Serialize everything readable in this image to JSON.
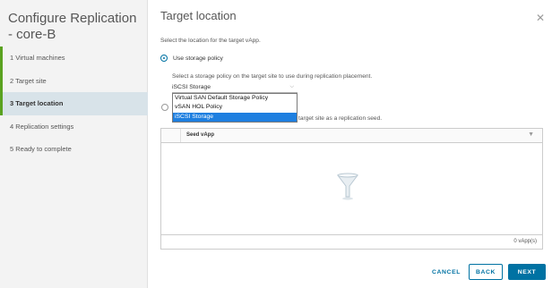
{
  "wizard": {
    "title": "Configure Replication - core-B",
    "steps": [
      {
        "label": "1  Virtual machines"
      },
      {
        "label": "2  Target site"
      },
      {
        "label": "3  Target location"
      },
      {
        "label": "4  Replication settings"
      },
      {
        "label": "5  Ready to complete"
      }
    ]
  },
  "page": {
    "title": "Target location",
    "subtitle": "Select the location for the target vApp.",
    "radio_storage_policy": "Use storage policy",
    "storage_policy_helper": "Select a storage policy on the target site to use during replication placement.",
    "storage_policy_selected": "iSCSI Storage",
    "storage_policy_options": [
      "Virtual SAN Default Storage Policy",
      "vSAN HOL Policy",
      "iSCSI Storage"
    ],
    "seed_text_visible": "target site as a replication seed."
  },
  "grid": {
    "column_header": "Seed vApp",
    "footer_count": "0 vApp(s)"
  },
  "footer": {
    "cancel": "CANCEL",
    "back": "BACK",
    "next": "NEXT"
  },
  "colors": {
    "accent": "#0072a3",
    "active_step_bg": "#d8e3e9",
    "completed_step": "#5aa220",
    "dropdown_highlight": "#1e7fe0"
  },
  "icons": {
    "close": "close-icon",
    "filter": "filter-icon",
    "empty_state": "funnel-placeholder-icon"
  }
}
